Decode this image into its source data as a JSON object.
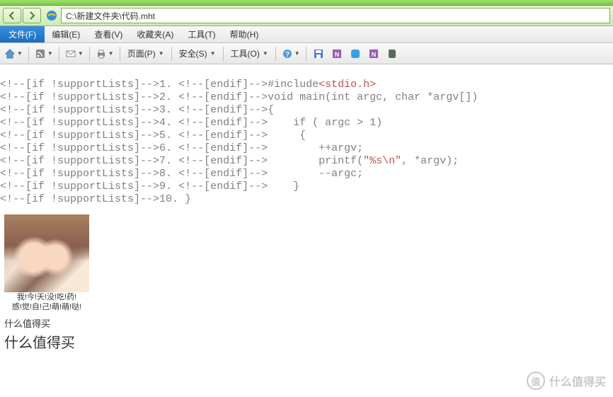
{
  "address": "C:\\新建文件夹\\代码.mht",
  "menus": {
    "file": "文件(F)",
    "edit": "编辑(E)",
    "view": "查看(V)",
    "favorites": "收藏夹(A)",
    "tools": "工具(T)",
    "help": "帮助(H)"
  },
  "toolbar": {
    "page": "页面(P)",
    "safety": "安全(S)",
    "tools": "工具(O)"
  },
  "code": {
    "prefix": "<!--[if !supportLists]-->",
    "endif": "<!--[endif]-->",
    "lines": [
      {
        "n": "1.",
        "body": {
          "plain": "#include",
          "inc": "<stdio.h>"
        }
      },
      {
        "n": "2.",
        "body": {
          "kw1": "void",
          "t1": " main(",
          "kw2": "int",
          "t2": " argc, ",
          "kw3": "char",
          "t3": " *argv[])"
        }
      },
      {
        "n": "3.",
        "body": {
          "t": "{"
        }
      },
      {
        "n": "4.",
        "body": {
          "t1": "    if ( argc ",
          "op": ">",
          "t2": " 1)"
        }
      },
      {
        "n": "5.",
        "body": {
          "t": "     {"
        }
      },
      {
        "n": "6.",
        "body": {
          "t": "        ++argv;"
        }
      },
      {
        "n": "7.",
        "body": {
          "t1": "        printf(",
          "str": "\"%s\\n\"",
          "t2": ", *argv);"
        }
      },
      {
        "n": "8.",
        "body": {
          "t": "        --argc;"
        }
      },
      {
        "n": "9.",
        "body": {
          "t": "    }"
        }
      },
      {
        "n": "10.",
        "body": {
          "t": "}"
        }
      }
    ]
  },
  "caption": {
    "l1": "我!今!天!没!吃!药!",
    "l2": "感!觉!自!己!萌!萌!哒!"
  },
  "smzdm": "什么值得买",
  "watermark": {
    "char": "值",
    "text": "什么值得买"
  }
}
